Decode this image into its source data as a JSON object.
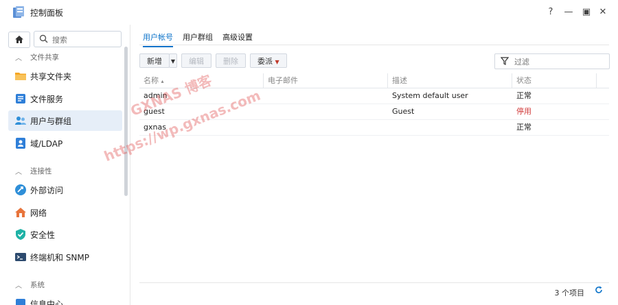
{
  "window": {
    "title": "控制面板",
    "help": "?",
    "minimize": "—",
    "maximize": "▣",
    "close": "✕"
  },
  "sidebar": {
    "search_placeholder": "搜索",
    "sections": [
      {
        "title": "文件共享",
        "items": [
          "共享文件夹",
          "文件服务",
          "用户与群组",
          "域/LDAP"
        ]
      },
      {
        "title": "连接性",
        "items": [
          "外部访问",
          "网络",
          "安全性",
          "终端机和 SNMP"
        ]
      },
      {
        "title": "系统",
        "items": [
          "信息中心"
        ]
      }
    ],
    "active_item": "用户与群组"
  },
  "tabs": [
    "用户帐号",
    "用户群组",
    "高级设置"
  ],
  "toolbar": {
    "create": "新增",
    "edit": "编辑",
    "delete": "删除",
    "assign": "委派",
    "filter_placeholder": "过滤"
  },
  "table": {
    "columns": [
      "名称",
      "电子邮件",
      "描述",
      "状态"
    ],
    "rows": [
      {
        "name": "admin",
        "email": "",
        "description": "System default user",
        "status": "正常"
      },
      {
        "name": "guest",
        "email": "",
        "description": "Guest",
        "status": "停用"
      },
      {
        "name": "gxnas",
        "email": "",
        "description": "",
        "status": "正常"
      }
    ]
  },
  "footer": {
    "count": "3 个项目"
  },
  "watermark": {
    "line1": "GXNAS 博客",
    "line2": "https://wp.gxnas.com"
  },
  "colors": {
    "accent": "#0a72c9",
    "disabled_status": "#d13b3b",
    "active_nav": "#e6eef8"
  }
}
